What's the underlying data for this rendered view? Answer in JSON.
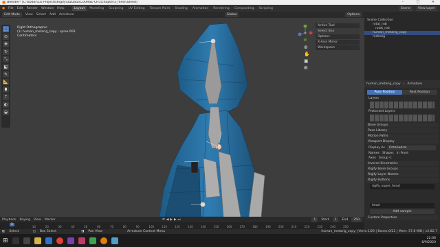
{
  "window": {
    "title": "Blender* [C:\\Sodor\\CG Projects\\Rigify\\3DData\\COURSE-CH1\\chapter3_mesh.blend]"
  },
  "menu": [
    "File",
    "Edit",
    "Render",
    "Window",
    "Help"
  ],
  "workspaces": [
    "Layout",
    "Modeling",
    "Sculpting",
    "UV Editing",
    "Texture Paint",
    "Shading",
    "Animation",
    "Rendering",
    "Compositing",
    "Scripting"
  ],
  "scene_label": "Scene",
  "view_layer_label": "View Layer",
  "options_label": "Options",
  "viewport_header": {
    "mode": "Edit Mode",
    "items": [
      "View",
      "Select",
      "Add",
      "Armature"
    ],
    "orientation": "Global"
  },
  "viewport_info": {
    "line1": "Right Orthographic",
    "line2": "(1) human_metarig_copy : spine.003",
    "line3": "Centimeters"
  },
  "n_panel": {
    "active_tool": "Active Tool",
    "select_box": "Select Box",
    "options": "Options",
    "x_axis_mirror": "X-Axis Mirror",
    "workspace": "Workspace"
  },
  "outliner": {
    "items": [
      "Scene Collection",
      "rotat_rob",
      "rotat_rob",
      "human_metarig_copy",
      "metarig"
    ]
  },
  "properties": {
    "object_name": "human_metarig_copy",
    "data_label": "Armature",
    "pose_position": "Pose Position",
    "rest_position": "Rest Position",
    "layers": "Layers",
    "protected_layers": "Protected Layers",
    "panels": [
      "Bone Groups",
      "Pose Library",
      "Motion Paths",
      "Viewport Display"
    ],
    "display_as_label": "Display As",
    "display_as_value": "Octahedral",
    "names": "Names",
    "shapes": "Shapes",
    "in_front": "In Front",
    "axes": "Axes",
    "group_colors": "Group C",
    "panels2": [
      "Inverse Kinematics",
      "Rigify Bone Groups",
      "Rigify Layer Names",
      "Rigify Buttons"
    ],
    "rig_field": "rigify_super_head",
    "head_field": "head",
    "add_sample": "Add sample",
    "custom_properties": "Custom Properties"
  },
  "timeline": {
    "header": [
      "Playback",
      "Keying",
      "View",
      "Marker"
    ],
    "current_frame": "1",
    "start_label": "Start",
    "start": "1",
    "end_label": "End",
    "end": "250",
    "ticks": [
      "10",
      "20",
      "30",
      "40",
      "50",
      "60",
      "70",
      "80",
      "90",
      "100",
      "110",
      "120",
      "130",
      "140",
      "150",
      "160",
      "170",
      "180",
      "190",
      "200",
      "210",
      "220",
      "230",
      "240",
      "250"
    ]
  },
  "status": {
    "left": "Select",
    "mid1": "Box Select",
    "mid2": "Pan View",
    "mid3": "Armature Context Menu",
    "right": "human_metarig_copy | Verts:1/29 | Bones:0/22 | Mem: 57.8 MiB | v2.82.7"
  },
  "clock": {
    "time": "22:06",
    "date": "6/9/2020"
  },
  "colors": {
    "accent": "#4772b3",
    "mesh": "#2b6ea0",
    "bone": "#9a9a9a"
  }
}
